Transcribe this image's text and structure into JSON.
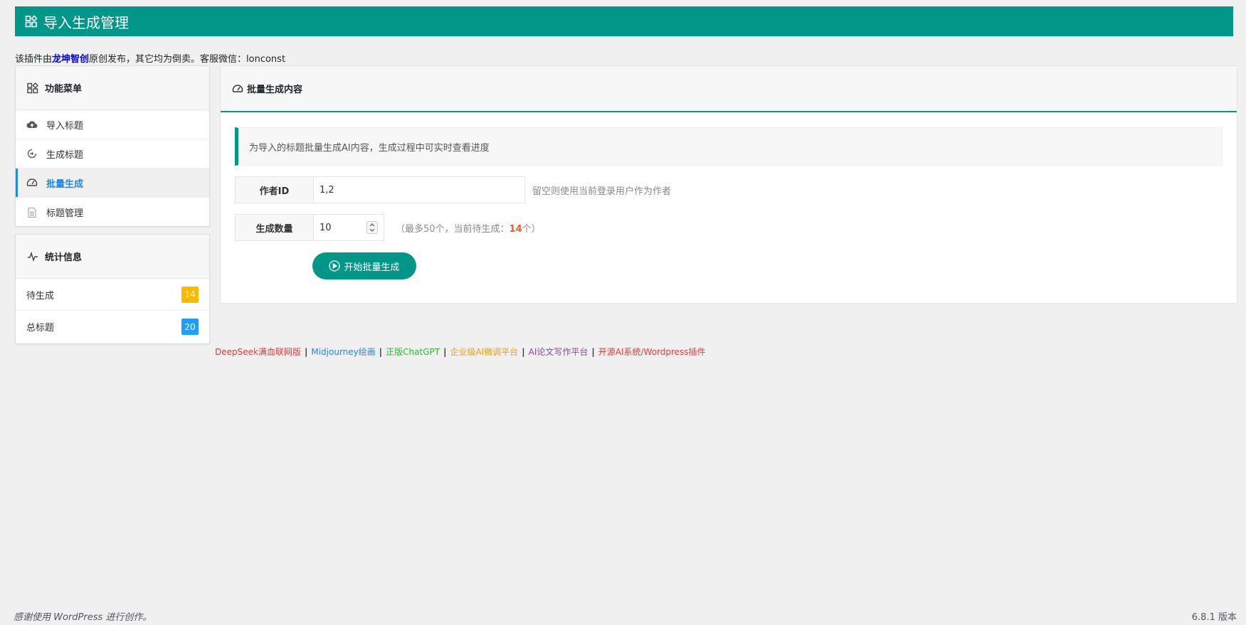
{
  "header": {
    "title": "导入生成管理"
  },
  "notice": {
    "prefix": "该插件由",
    "brand": "龙坤智创",
    "suffix": "原创发布，其它均为倒卖。客服微信：lonconst"
  },
  "sidebar": {
    "menu_title": "功能菜单",
    "items": [
      {
        "label": "导入标题",
        "icon": "cloud-upload-icon"
      },
      {
        "label": "生成标题",
        "icon": "rotate-icon"
      },
      {
        "label": "批量生成",
        "icon": "gauge-icon",
        "active": true
      },
      {
        "label": "标题管理",
        "icon": "document-icon"
      }
    ],
    "stats_title": "统计信息",
    "stats": [
      {
        "label": "待生成",
        "value": "14",
        "color": "#ffb800"
      },
      {
        "label": "总标题",
        "value": "20",
        "color": "#1e9fff"
      }
    ]
  },
  "main": {
    "title": "批量生成内容",
    "description": "为导入的标题批量生成AI内容，生成过程中可实时查看进度",
    "author": {
      "label": "作者ID",
      "value": "1,2",
      "hint": "留空则使用当前登录用户作为作者"
    },
    "count": {
      "label": "生成数量",
      "value": "10",
      "hint_prefix": "（最多50个，当前待生成：",
      "pending": "14",
      "hint_suffix": "个）"
    },
    "start_button": "开始批量生成"
  },
  "links": [
    {
      "label": "DeepSeek满血联网版",
      "color": "#e53935"
    },
    {
      "label": "Midjourney绘画",
      "color": "#1e88e5"
    },
    {
      "label": "正版ChatGPT",
      "color": "#2eb82e"
    },
    {
      "label": "企业级AI微调平台",
      "color": "#f39c12"
    },
    {
      "label": "AI论文写作平台",
      "color": "#8e44ad"
    },
    {
      "label": "开源AI系统/Wordpress插件",
      "color": "#e53935"
    }
  ],
  "footer": {
    "left": "感谢使用 WordPress 进行创作。",
    "version": "6.8.1 版本"
  },
  "colors": {
    "accent": "#009688",
    "active": "#1e88e5",
    "highlight": "#ff5722"
  }
}
